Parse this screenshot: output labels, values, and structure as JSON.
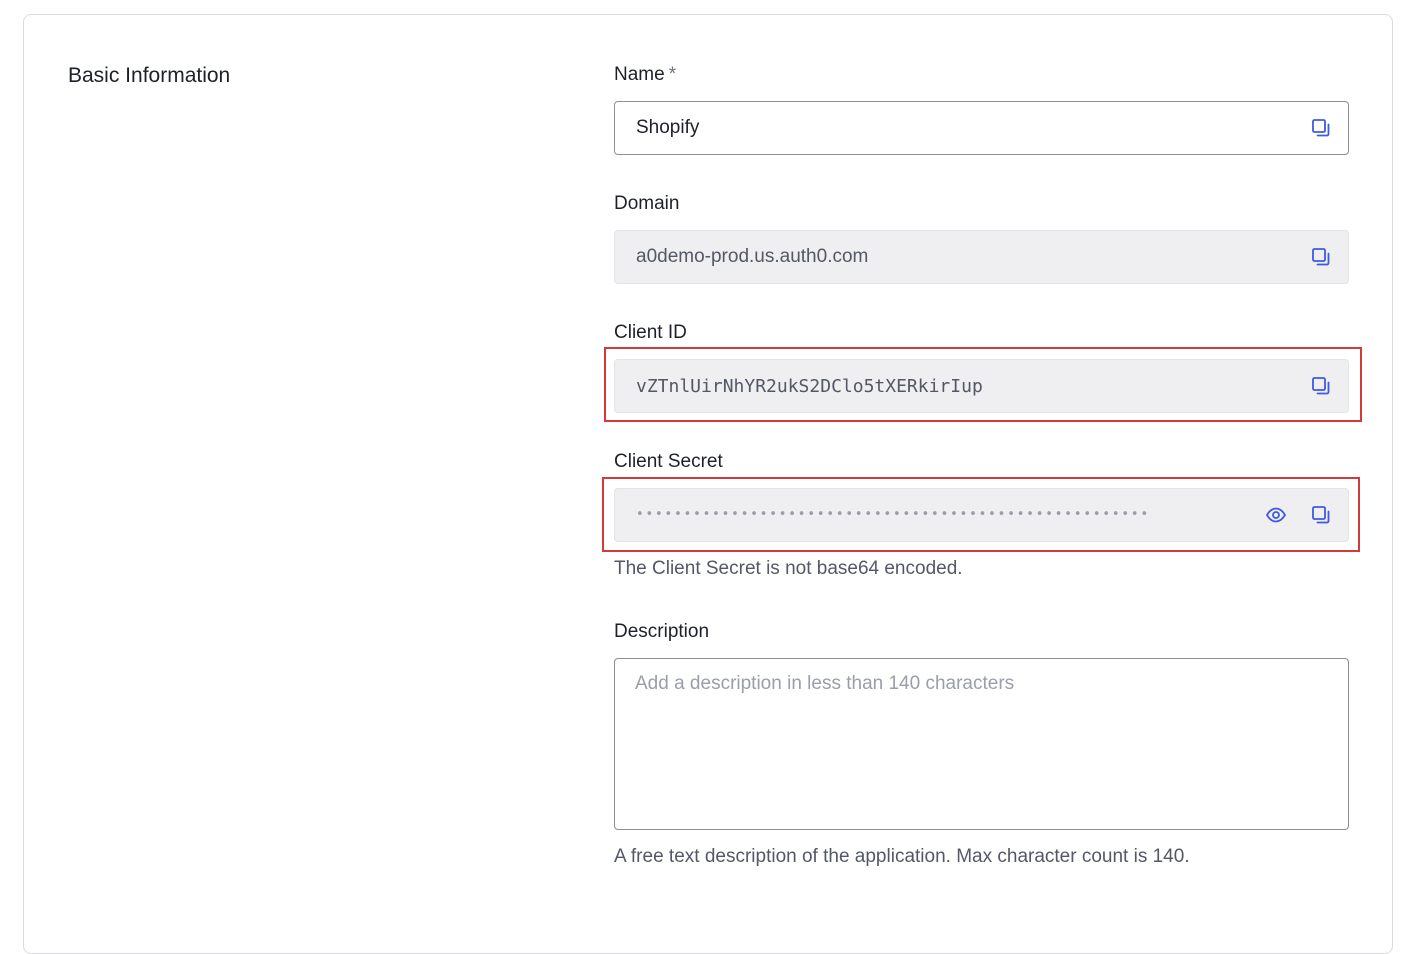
{
  "section": {
    "title": "Basic Information"
  },
  "fields": {
    "name": {
      "label": "Name",
      "required_marker": "*",
      "value": "Shopify",
      "copy_icon": "copy-icon"
    },
    "domain": {
      "label": "Domain",
      "value": "a0demo-prod.us.auth0.com",
      "copy_icon": "copy-icon"
    },
    "client_id": {
      "label": "Client ID",
      "value": "vZTnlUirNhYR2ukS2DClo5tXERkirIup",
      "copy_icon": "copy-icon"
    },
    "client_secret": {
      "label": "Client Secret",
      "masked_value": "••••••••••••••••••••••••••••••••••••••••••••••••••••••",
      "reveal_icon": "eye-icon",
      "copy_icon": "copy-icon",
      "helper": "The Client Secret is not base64 encoded."
    },
    "description": {
      "label": "Description",
      "placeholder": "Add a description in less than 140 characters",
      "value": "",
      "helper": "A free text description of the application. Max character count is 140."
    }
  },
  "colors": {
    "accent": "#3f59e4",
    "highlight": "#d23b3b",
    "readonly_bg": "#efeff1",
    "border": "#8a8e96"
  }
}
